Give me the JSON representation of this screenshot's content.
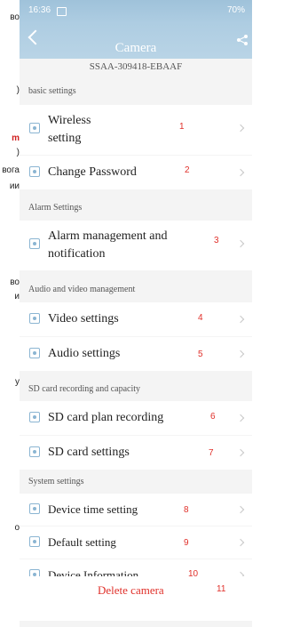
{
  "background_doc": {
    "fragments": [
      "во",
      ")",
      "m",
      ")",
      "вога",
      "ии",
      "во",
      "и",
      "у",
      "о"
    ],
    "highlight": "m"
  },
  "status_bar": {
    "time": "16:36",
    "right": "70%"
  },
  "header": {
    "title": "Camera"
  },
  "serial": "SSAA-309418-EBAAF",
  "sections": [
    {
      "label": "basic settings"
    },
    {
      "label": "Alarm Settings"
    },
    {
      "label": "Audio and video management"
    },
    {
      "label": "SD card recording and capacity"
    },
    {
      "label": "System settings"
    }
  ],
  "rows": [
    {
      "label": "Wireless setting",
      "line1": "Wireless",
      "line2": "setting",
      "num": "1",
      "icon": "wifi-icon"
    },
    {
      "label": "Change Password",
      "num": "2",
      "icon": "lock-icon"
    },
    {
      "label": "Alarm management and notification",
      "line1": "Alarm management and",
      "line2": "notification",
      "num": "3",
      "icon": "alarm-icon"
    },
    {
      "label": "Video settings",
      "num": "4",
      "icon": "video-icon"
    },
    {
      "label": "Audio settings",
      "num": "5",
      "icon": "audio-icon"
    },
    {
      "label": "SD card plan recording",
      "num": "6",
      "icon": "sd-record-icon"
    },
    {
      "label": "SD card settings",
      "num": "7",
      "icon": "sd-card-icon"
    },
    {
      "label": "Device time setting",
      "num": "8",
      "icon": "clock-icon"
    },
    {
      "label": "Default setting",
      "num": "9",
      "icon": "reset-icon"
    },
    {
      "label": "Device Information",
      "num": "10",
      "icon": "info-icon"
    }
  ],
  "delete": {
    "label": "Delete camera",
    "num": "11"
  },
  "colors": {
    "header": "#aecde2",
    "accent_red": "#e0302a",
    "icon": "#8bb5d2"
  }
}
